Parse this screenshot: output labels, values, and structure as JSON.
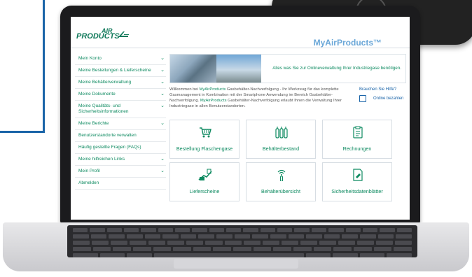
{
  "brand": {
    "logo_line1": "AIR",
    "logo_line2": "PRODUCTS",
    "site_title": "MyAirProducts™"
  },
  "sidebar": {
    "items": [
      {
        "label": "Mein Konto",
        "expandable": true
      },
      {
        "label": "Meine Bestellungen & Lieferscheine",
        "expandable": true
      },
      {
        "label": "Meine Behälterverwaltung",
        "expandable": true
      },
      {
        "label": "Meine Dokumente",
        "expandable": true
      },
      {
        "label": "Meine Qualitäts- und Sicherheitsinformationen",
        "expandable": true
      },
      {
        "label": "Meine Berichte",
        "expandable": true
      },
      {
        "label": "Benutzerstandorte verwalten",
        "expandable": false
      },
      {
        "label": "Häufig gestellte Fragen (FAQs)",
        "expandable": false
      },
      {
        "label": "Meine hilfreichen Links",
        "expandable": true
      },
      {
        "label": "Mein Profil",
        "expandable": true
      },
      {
        "label": "Abmelden",
        "expandable": false
      }
    ],
    "chevron": "⌄"
  },
  "hero": {
    "text": "Alles was Sie zur Onlineverwaltung Ihrer Industriegase benötigen."
  },
  "intro": {
    "p1": "Willkommen bei ",
    "brand1": "MyAirProducts",
    "p2": " Gasbehälter-Nachverfolgung - Ihr Werkzeug für das komplette Gasmanagement in Kombination mit der Smartphone Anwendung im Bereich Gasbehälter-Nachverfolgung. ",
    "brand2": "MyAirProducts",
    "p3": " Gasbehälter-Nachverfolgung erlaubt Ihnen die Verwaltung Ihrer Industriegase in allen Benutzerstandorten."
  },
  "help": {
    "title": "Brauchen Sie Hilfe?",
    "link": "Online bezahlen"
  },
  "tiles": [
    {
      "label": "Bestellung Flaschengase",
      "icon": "cart-icon"
    },
    {
      "label": "Behälterbestand",
      "icon": "cylinders-icon"
    },
    {
      "label": "Rechnungen",
      "icon": "invoice-icon"
    },
    {
      "label": "Lieferscheine",
      "icon": "delivery-icon"
    },
    {
      "label": "Behälterübersicht",
      "icon": "signal-tracking-icon"
    },
    {
      "label": "Sicherheitsdatenblätter",
      "icon": "safety-sheet-icon"
    }
  ],
  "colors": {
    "accent_green": "#0d8a60",
    "link_blue": "#1a64a8",
    "frame": "#1b1b1d"
  }
}
